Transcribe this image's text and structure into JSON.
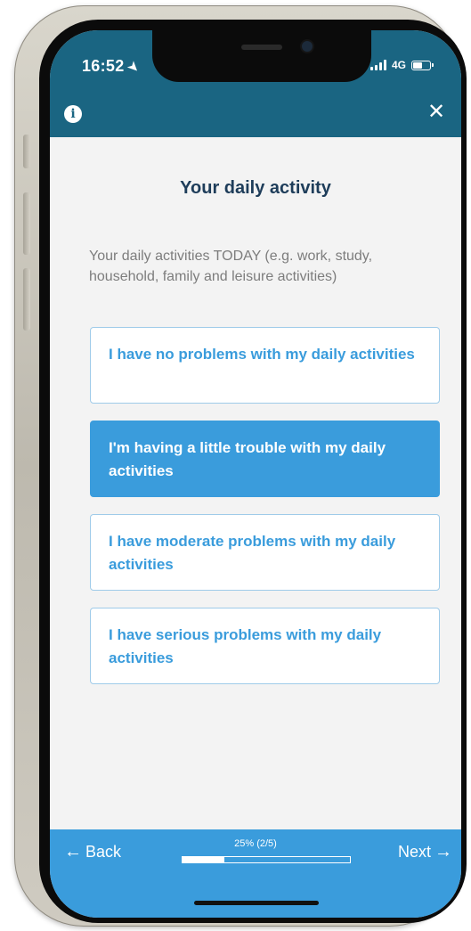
{
  "status_bar": {
    "time": "16:52",
    "network": "4G",
    "battery_level": 0.6
  },
  "header": {
    "info_icon": "info-icon",
    "close_icon": "close-icon",
    "info_glyph": "i",
    "close_glyph": "✕",
    "bar_color": "#1a6582"
  },
  "main": {
    "title": "Your daily activity",
    "question": "Your daily activities TODAY (e.g. work, study, household, family and leisure activities)",
    "options": [
      {
        "label": "I have no problems with my daily activities",
        "selected": false
      },
      {
        "label": "I'm having a little trouble with my daily activities",
        "selected": true
      },
      {
        "label": "I have moderate problems with my daily activities",
        "selected": false
      },
      {
        "label": "I have serious problems with my daily activities",
        "selected": false
      }
    ],
    "accent_color": "#3a9cdc"
  },
  "footer": {
    "back_label": "Back",
    "next_label": "Next",
    "back_arrow": "←",
    "next_arrow": "→",
    "progress_text": "25% (2/5)",
    "progress_fraction": 0.25
  }
}
